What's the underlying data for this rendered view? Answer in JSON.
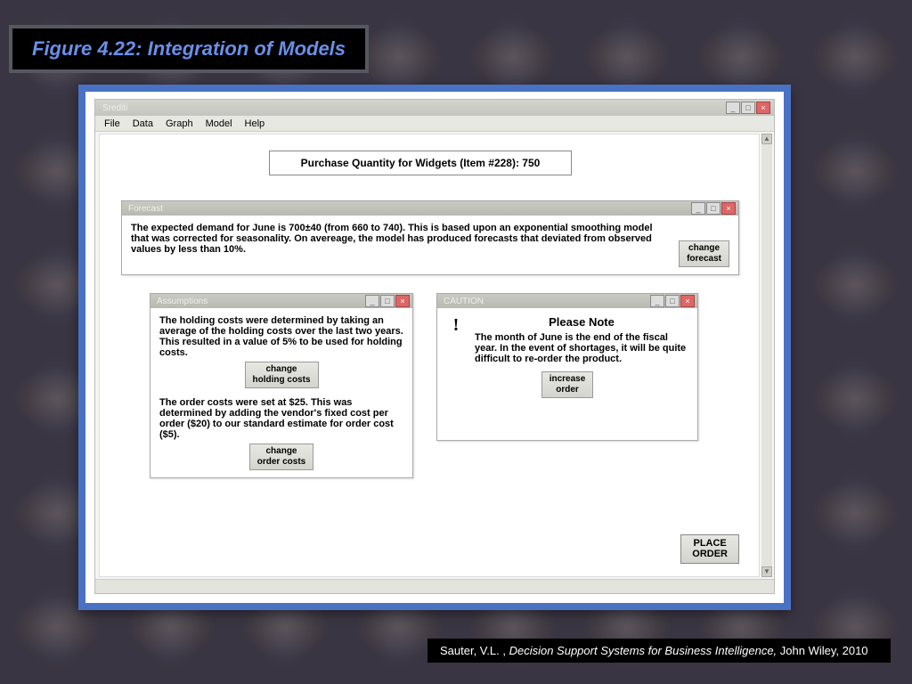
{
  "figure_title": "Figure 4.22:  Integration of Models",
  "app": {
    "title": "Srediti",
    "menu": {
      "file": "File",
      "data": "Data",
      "graph": "Graph",
      "model": "Model",
      "help": "Help"
    }
  },
  "purchase_label": "Purchase Quantity for Widgets (Item #228):  750",
  "forecast": {
    "title": "Forecast",
    "text": "The expected demand for June is 700±40 (from 660 to 740).  This is based upon an exponential smoothing model that was corrected for seasonality.  On avereage, the model has produced forecasts that deviated from observed values by less than 10%.",
    "change_btn": "change\nforecast"
  },
  "assumptions": {
    "title": "Assumptions",
    "holding_text": "The holding costs were determined by taking an average of the holding costs over the last two years.  This resulted in a value of 5% to be used for holding costs.",
    "holding_btn": "change\nholding costs",
    "order_text": "The order costs were set at $25.  This was determined by adding the vendor's fixed cost per order ($20) to our standard estimate for order cost ($5).",
    "order_btn": "change\norder costs"
  },
  "caution": {
    "title": "CAUTION",
    "heading": "Please Note",
    "text": "The month of June is the end of the fiscal year.  In the event of shortages, it will be quite difficult to re-order the product.",
    "increase_btn": "increase\norder"
  },
  "place_order": "PLACE\nORDER",
  "citation": {
    "author": "Sauter, V.L. , ",
    "title": "Decision Support Systems for Business Intelligence, ",
    "pub": "John Wiley, 2010"
  }
}
